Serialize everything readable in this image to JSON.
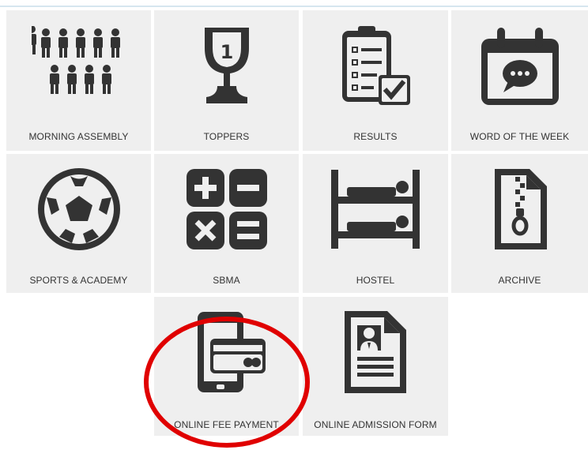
{
  "tiles": [
    {
      "label": "MORNING ASSEMBLY",
      "icon": "morning-assembly-icon"
    },
    {
      "label": "TOPPERS",
      "icon": "trophy-icon"
    },
    {
      "label": "RESULTS",
      "icon": "results-checklist-icon"
    },
    {
      "label": "WORD OF THE WEEK",
      "icon": "calendar-chat-icon"
    },
    {
      "label": "SPORTS & ACADEMY",
      "icon": "soccer-ball-icon"
    },
    {
      "label": "SBMA",
      "icon": "calculator-icon"
    },
    {
      "label": "HOSTEL",
      "icon": "bunk-bed-icon"
    },
    {
      "label": "ARCHIVE",
      "icon": "zip-file-icon"
    },
    {
      "label": "ONLINE FEE PAYMENT",
      "icon": "mobile-card-payment-icon"
    },
    {
      "label": "ONLINE ADMISSION FORM",
      "icon": "admission-form-icon"
    }
  ],
  "colors": {
    "tile_bg": "#efefef",
    "icon": "#333333",
    "highlight": "#e00000"
  }
}
